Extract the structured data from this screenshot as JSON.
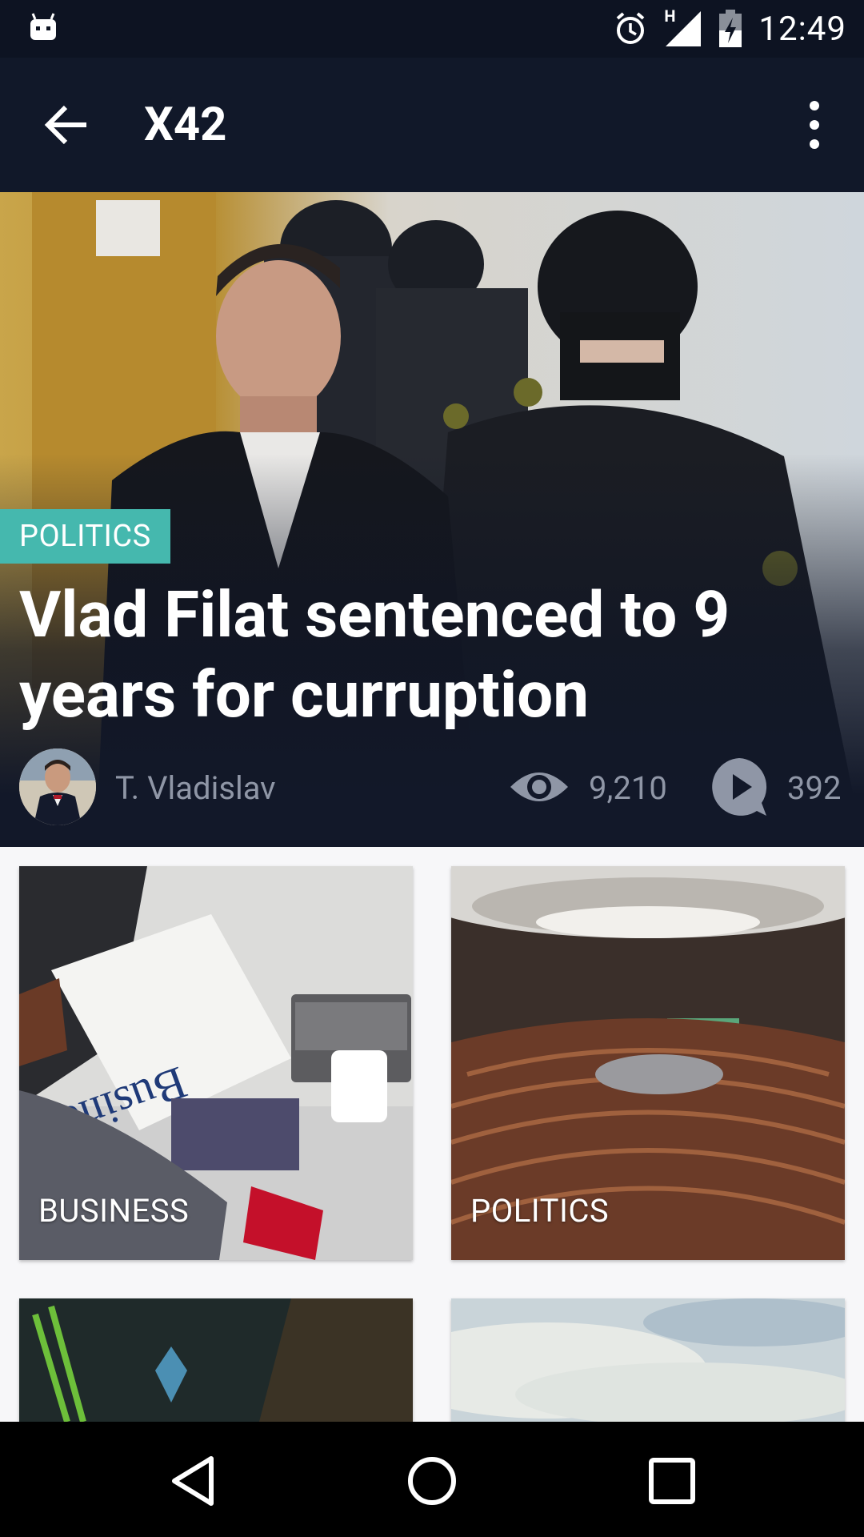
{
  "status_bar": {
    "time": "12:49",
    "icons": [
      "android-icon",
      "alarm-icon",
      "signal-icon",
      "battery-charging-icon"
    ],
    "network_label": "H"
  },
  "app_bar": {
    "title": "X42",
    "back_icon": "arrow-back-icon",
    "menu_icon": "more-vert-icon"
  },
  "hero": {
    "category": "POLITICS",
    "category_color": "#45b8ae",
    "title": "Vlad Filat sentenced to 9 years for curruption",
    "author": "T. Vladislav",
    "views": "9,210",
    "comments": "392",
    "views_icon": "eye-icon",
    "comments_icon": "comment-play-icon"
  },
  "categories": [
    {
      "label": "BUSINESS"
    },
    {
      "label": "POLITICS"
    },
    {
      "label": ""
    },
    {
      "label": ""
    }
  ],
  "nav_bar": {
    "icons": [
      "nav-back-icon",
      "nav-home-icon",
      "nav-recents-icon"
    ]
  },
  "colors": {
    "status_bar": "#0d1322",
    "app_bar": "#111829",
    "background": "#f7f7f9",
    "accent": "#45b8ae",
    "meta_text": "#8f96a6"
  }
}
